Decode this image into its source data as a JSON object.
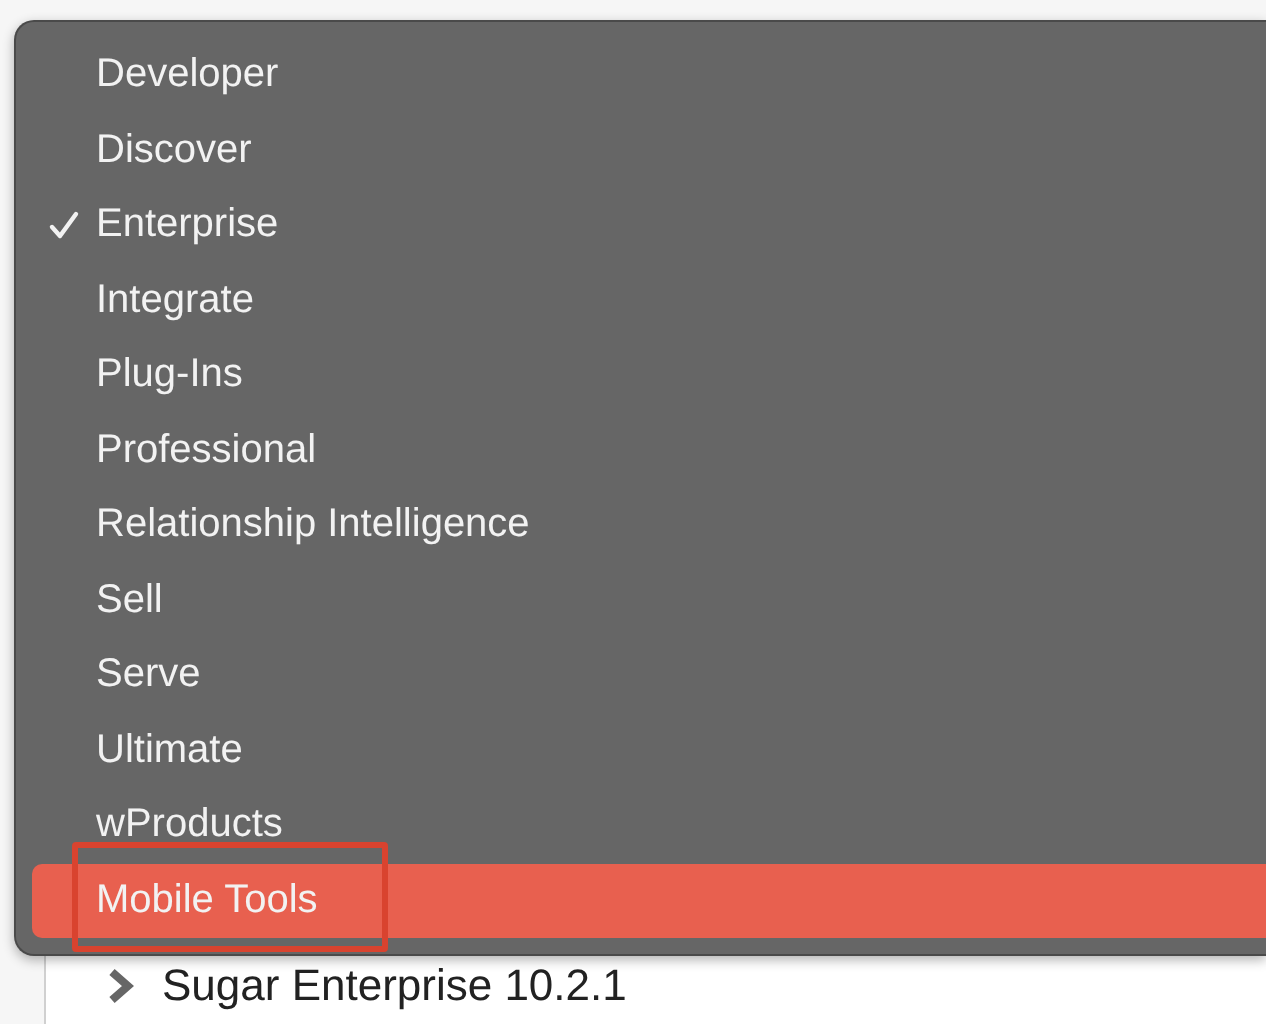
{
  "menu": {
    "items": [
      {
        "label": "Developer",
        "checked": false,
        "selected": false,
        "annotated": false
      },
      {
        "label": "Discover",
        "checked": false,
        "selected": false,
        "annotated": false
      },
      {
        "label": "Enterprise",
        "checked": true,
        "selected": false,
        "annotated": false
      },
      {
        "label": "Integrate",
        "checked": false,
        "selected": false,
        "annotated": false
      },
      {
        "label": "Plug-Ins",
        "checked": false,
        "selected": false,
        "annotated": false
      },
      {
        "label": "Professional",
        "checked": false,
        "selected": false,
        "annotated": false
      },
      {
        "label": "Relationship Intelligence",
        "checked": false,
        "selected": false,
        "annotated": false
      },
      {
        "label": "Sell",
        "checked": false,
        "selected": false,
        "annotated": false
      },
      {
        "label": "Serve",
        "checked": false,
        "selected": false,
        "annotated": false
      },
      {
        "label": "Ultimate",
        "checked": false,
        "selected": false,
        "annotated": false
      },
      {
        "label": "wProducts",
        "checked": false,
        "selected": false,
        "annotated": false
      },
      {
        "label": "Mobile Tools",
        "checked": false,
        "selected": true,
        "annotated": true
      }
    ]
  },
  "tree": {
    "items": [
      {
        "label": "Sugar Enterprise 10.2.1",
        "expanded": false
      }
    ]
  }
}
